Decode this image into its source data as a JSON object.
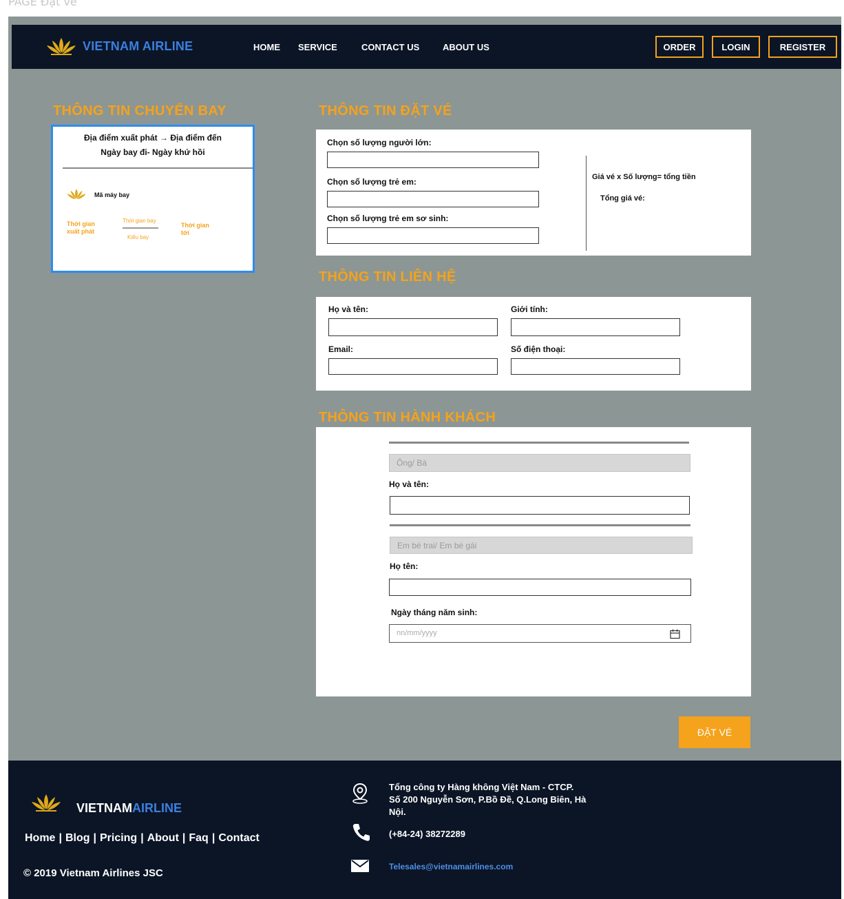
{
  "page_label": "PAGE Đặt vé",
  "header": {
    "logo_text": "VIETNAM AIRLINE",
    "nav": [
      "HOME",
      "SERVICE",
      "CONTACT US",
      "ABOUT US"
    ],
    "buttons": {
      "order": "ORDER",
      "login": "LOGIN",
      "register": "REGISTER"
    }
  },
  "flight_info": {
    "title": "THÔNG TIN CHUYẾN BAY",
    "route": "Địa điểm xuất phát → Địa điểm đến",
    "dates": "Ngày bay đi- Ngày khứ hồi",
    "plane_code": "Mã máy bay",
    "depart_time": "Thời gian xuất phát",
    "flight_time": "Thời gian bay",
    "flight_type": "Kiểu bay",
    "arrive_time": "Thời gian tới"
  },
  "booking_info": {
    "title": "THÔNG TIN ĐẶT VÉ",
    "adults_label": "Chọn số lượng người lớn:",
    "children_label": "Chọn số lượng trẻ em:",
    "infants_label": "Chọn số lượng trẻ em sơ sinh:",
    "formula": "Giá vé x Số lượng= tổng tiền",
    "total_label": "Tổng giá vé:"
  },
  "contact_info": {
    "title": "THÔNG TIN LIÊN HỆ",
    "name_label": "Họ và tên:",
    "gender_label": "Giới tính:",
    "email_label": "Email:",
    "phone_label": "Số điện thoại:"
  },
  "passenger_info": {
    "title": "THÔNG TIN HÀNH KHÁCH",
    "title_select": "Ông/ Bà",
    "adult_name_label": "Họ và tên:",
    "child_select": "Em bé trai/ Em bé gái",
    "child_name_label": "Họ tên:",
    "dob_label": "Ngày tháng năm sinh:",
    "dob_placeholder": "nn/mm/yyyy"
  },
  "book_button": "ĐẶT VÉ",
  "footer": {
    "brand_a": "VIETNAM",
    "brand_b": "AIRLINE",
    "links": [
      "Home",
      "Blog",
      "Pricing",
      "About",
      "Faq",
      "Contact"
    ],
    "separator": "|",
    "copyright": "© 2019 Vietnam Airlines JSC",
    "address_line1": "Tổng công ty Hàng không Việt Nam - CTCP.",
    "address_line2": "Số 200 Nguyễn Sơn, P.Bồ Đề, Q.Long Biên, Hà",
    "address_line3": "Nội.",
    "phone": "(+84-24) 38272289",
    "email": "Telesales@vietnamairlines.com"
  },
  "colors": {
    "navy": "#0b1526",
    "orange": "#f5a21c",
    "blue": "#3b7fe0",
    "gray_bg": "#8c9694"
  },
  "icons": [
    "lotus-logo-icon",
    "location-pin-icon",
    "phone-icon",
    "mail-icon",
    "calendar-icon"
  ]
}
